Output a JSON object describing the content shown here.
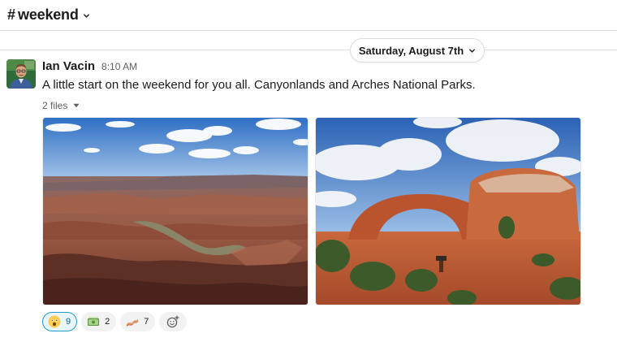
{
  "channel": {
    "hash": "#",
    "name": "weekend"
  },
  "divider": {
    "date": "Saturday, August 7th"
  },
  "message": {
    "sender": "Ian Vacin",
    "time": "8:10 AM",
    "text": "A little start on the weekend for you all. Canyonlands and Arches National Parks.",
    "files_label": "2 files"
  },
  "attachments": [
    {
      "subject": "Canyonlands canyon overlook photo"
    },
    {
      "subject": "Arches natural arch photo"
    }
  ],
  "reactions": [
    {
      "emoji": "astonished-face",
      "count": "9",
      "active": true
    },
    {
      "emoji": "money-stack",
      "count": "2",
      "active": false
    },
    {
      "emoji": "bacon",
      "count": "7",
      "active": false
    }
  ],
  "colors": {
    "text": "#1d1c1d",
    "muted": "#616061",
    "active_reaction_border": "#1d9bd1",
    "active_reaction_bg": "#e8f5fa",
    "divider": "#dddddd"
  }
}
